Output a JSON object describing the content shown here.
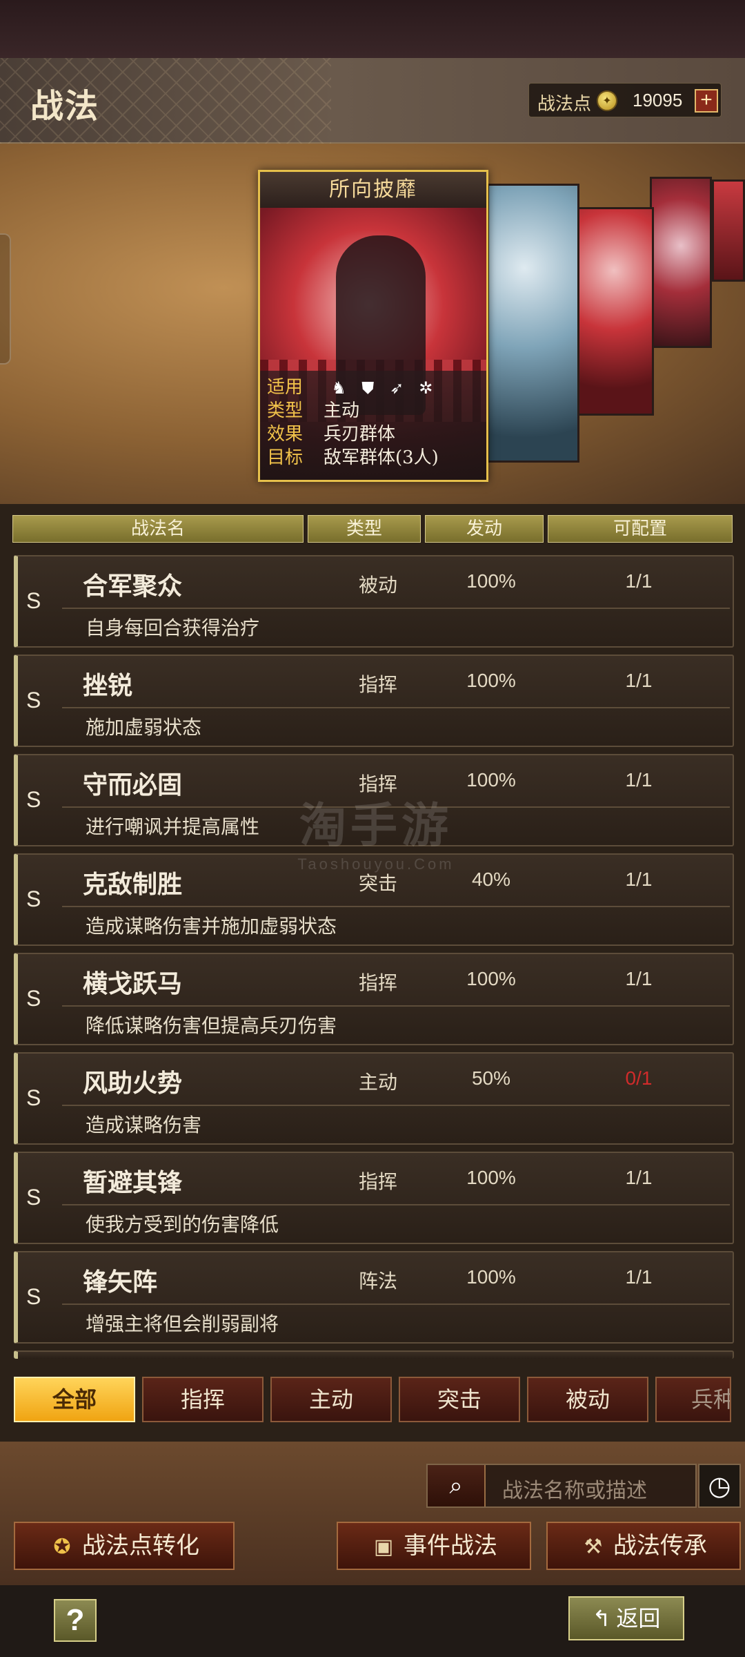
{
  "header": {
    "title": "战法",
    "points_label": "战法点",
    "points_value": "19095",
    "add_symbol": "+"
  },
  "featured_card": {
    "name": "所向披靡",
    "rows": [
      {
        "key": "适用",
        "icons": [
          "horse-icon",
          "shield-icon",
          "bow-icon",
          "wheel-icon"
        ]
      },
      {
        "key": "类型",
        "value": "主动"
      },
      {
        "key": "效果",
        "value": "兵刃群体"
      },
      {
        "key": "目标",
        "value": "敌军群体(3人)"
      }
    ]
  },
  "table": {
    "headers": [
      "战法名",
      "类型",
      "发动",
      "可配置"
    ],
    "rows": [
      {
        "grade": "S",
        "name": "合军聚众",
        "type": "被动",
        "rate": "100%",
        "available": "1/1",
        "desc": "自身每回合获得治疗",
        "available_red": false
      },
      {
        "grade": "S",
        "name": "挫锐",
        "type": "指挥",
        "rate": "100%",
        "available": "1/1",
        "desc": "施加虚弱状态",
        "available_red": false
      },
      {
        "grade": "S",
        "name": "守而必固",
        "type": "指挥",
        "rate": "100%",
        "available": "1/1",
        "desc": "进行嘲讽并提高属性",
        "available_red": false
      },
      {
        "grade": "S",
        "name": "克敌制胜",
        "type": "突击",
        "rate": "40%",
        "available": "1/1",
        "desc": "造成谋略伤害并施加虚弱状态",
        "available_red": false
      },
      {
        "grade": "S",
        "name": "横戈跃马",
        "type": "指挥",
        "rate": "100%",
        "available": "1/1",
        "desc": "降低谋略伤害但提高兵刃伤害",
        "available_red": false
      },
      {
        "grade": "S",
        "name": "风助火势",
        "type": "主动",
        "rate": "50%",
        "available": "0/1",
        "desc": "造成谋略伤害",
        "available_red": true
      },
      {
        "grade": "S",
        "name": "暂避其锋",
        "type": "指挥",
        "rate": "100%",
        "available": "1/1",
        "desc": "使我方受到的伤害降低",
        "available_red": false
      },
      {
        "grade": "S",
        "name": "锋矢阵",
        "type": "阵法",
        "rate": "100%",
        "available": "1/1",
        "desc": "增强主将但会削弱副将",
        "available_red": false
      }
    ]
  },
  "watermark": {
    "main": "淘手游",
    "sub": "Taoshouyou.Com"
  },
  "filters": {
    "tabs": [
      "全部",
      "指挥",
      "主动",
      "突击",
      "被动",
      "兵种"
    ],
    "active_index": 0
  },
  "search": {
    "placeholder": "战法名称或描述"
  },
  "actions": {
    "convert": "战法点转化",
    "event": "事件战法",
    "inherit": "战法传承"
  },
  "footer": {
    "help": "?",
    "back": "返回"
  }
}
